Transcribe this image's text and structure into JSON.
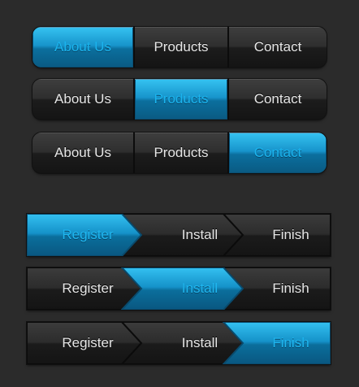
{
  "nav_tabs": {
    "labels": [
      "About Us",
      "Products",
      "Contact"
    ],
    "rows": [
      {
        "active_index": 0
      },
      {
        "active_index": 1
      },
      {
        "active_index": 2
      }
    ]
  },
  "wizard": {
    "labels": [
      "Register",
      "Install",
      "Finish"
    ],
    "rows": [
      {
        "active_index": 0
      },
      {
        "active_index": 1
      },
      {
        "active_index": 2
      }
    ]
  },
  "colors": {
    "background": "#2b2b2b",
    "accent": "#1fb6ef",
    "inactive_text": "#e6e6e6"
  }
}
